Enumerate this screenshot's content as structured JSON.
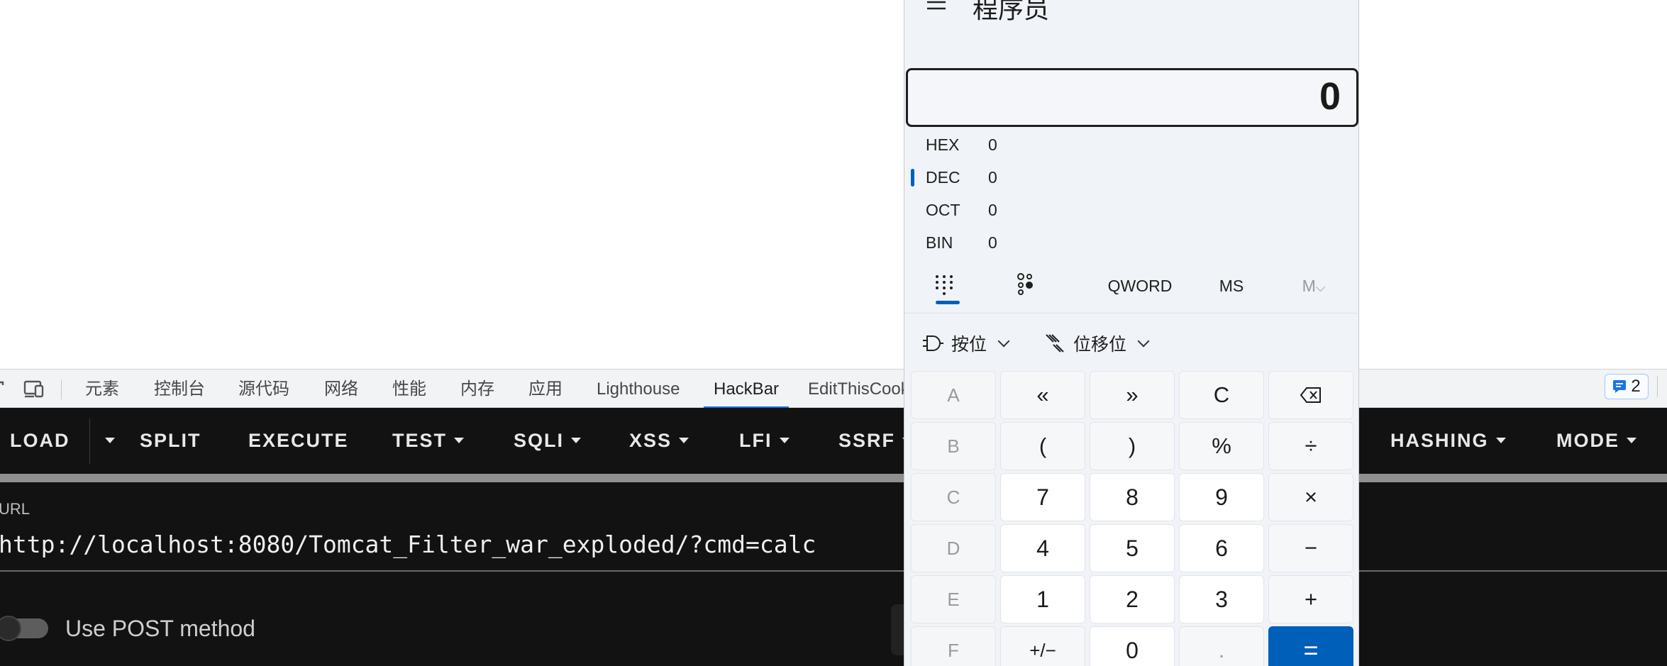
{
  "devtools": {
    "tabs": [
      {
        "label": "元素"
      },
      {
        "label": "控制台"
      },
      {
        "label": "源代码"
      },
      {
        "label": "网络"
      },
      {
        "label": "性能"
      },
      {
        "label": "内存"
      },
      {
        "label": "应用"
      },
      {
        "label": "Lighthouse"
      },
      {
        "label": "HackBar"
      },
      {
        "label": "EditThisCook"
      }
    ],
    "active_tab": "HackBar",
    "issues_count": "2",
    "accent_color": "#1a73e8"
  },
  "hackbar": {
    "buttons": [
      {
        "label": "LOAD"
      },
      {
        "label": "SPLIT"
      },
      {
        "label": "EXECUTE"
      },
      {
        "label": "TEST"
      },
      {
        "label": "SQLI"
      },
      {
        "label": "XSS"
      },
      {
        "label": "LFI"
      },
      {
        "label": "SSRF"
      },
      {
        "label": "HASHING"
      },
      {
        "label": "MODE"
      }
    ],
    "url_label": "URL",
    "url_value": "http://localhost:8080/Tomcat_Filter_war_exploded/?cmd=calc",
    "post_label": "Use POST method",
    "post_enabled": false
  },
  "calculator": {
    "title": "程序员",
    "display": "0",
    "radix": [
      {
        "name": "HEX",
        "value": "0"
      },
      {
        "name": "DEC",
        "value": "0"
      },
      {
        "name": "OCT",
        "value": "0"
      },
      {
        "name": "BIN",
        "value": "0"
      }
    ],
    "selected_radix": "DEC",
    "word_size": "QWORD",
    "memory_store": "MS",
    "memory_recall": "M",
    "bitwise_label": "按位",
    "bitshift_label": "位移位",
    "keys": {
      "r1": [
        "A",
        "«",
        "»",
        "C",
        "⌫"
      ],
      "r2": [
        "B",
        "(",
        ")",
        "%",
        "÷"
      ],
      "r3": [
        "C",
        "7",
        "8",
        "9",
        "×"
      ],
      "r4": [
        "D",
        "4",
        "5",
        "6",
        "−"
      ],
      "r5": [
        "E",
        "1",
        "2",
        "3",
        "+"
      ],
      "r6": [
        "F",
        "+/−",
        "0",
        ".",
        "="
      ]
    },
    "accent_color": "#005fb8"
  }
}
